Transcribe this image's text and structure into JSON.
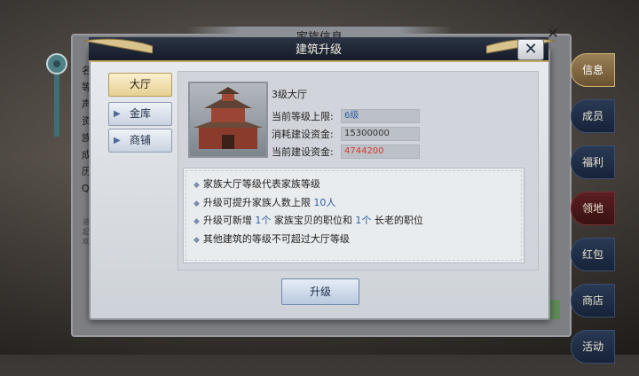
{
  "background_panel": {
    "title": "家族信息",
    "close_label": "✕",
    "labels": [
      "名",
      "等",
      "声",
      "资",
      "族",
      "成",
      "历",
      "QQ"
    ],
    "small_labels": [
      "进",
      "起",
      "欢"
    ]
  },
  "side_tabs": [
    {
      "label": "信息",
      "active": true
    },
    {
      "label": "成员",
      "active": false
    },
    {
      "label": "福利",
      "active": false
    },
    {
      "label": "领地",
      "active": false
    },
    {
      "label": "红包",
      "active": false
    },
    {
      "label": "商店",
      "active": false
    },
    {
      "label": "活动",
      "active": false
    }
  ],
  "dialog": {
    "title": "建筑升级",
    "close_label": "✕",
    "buildings": [
      {
        "label": "大厅",
        "active": true
      },
      {
        "label": "金库",
        "active": false
      },
      {
        "label": "商铺",
        "active": false
      }
    ],
    "building_name": "3级大厅",
    "info_rows": [
      {
        "label": "当前等级上限:",
        "value": "6级",
        "value_color": "#2f5fa6"
      },
      {
        "label": "消耗建设资金:",
        "value": "15300000",
        "value_color": "#333333"
      },
      {
        "label": "当前建设资金:",
        "value": "4744200",
        "value_color": "#d23a2a"
      }
    ],
    "descriptions": {
      "line1": "家族大厅等级代表家族等级",
      "line2_prefix": "升级可提升家族人数上限 ",
      "line2_value": "10人",
      "line3_prefix": "升级可新增 ",
      "line3_value1": "1个",
      "line3_mid": " 家族宝贝的职位和 ",
      "line3_value2": "1个",
      "line3_suffix": " 长老的职位",
      "line4": "其他建筑的等级不可超过大厅等级"
    },
    "upgrade_label": "升级"
  },
  "colors": {
    "accent_gold": "#c3a868",
    "value_blue": "#2f5fa6",
    "value_red": "#d23a2a"
  }
}
